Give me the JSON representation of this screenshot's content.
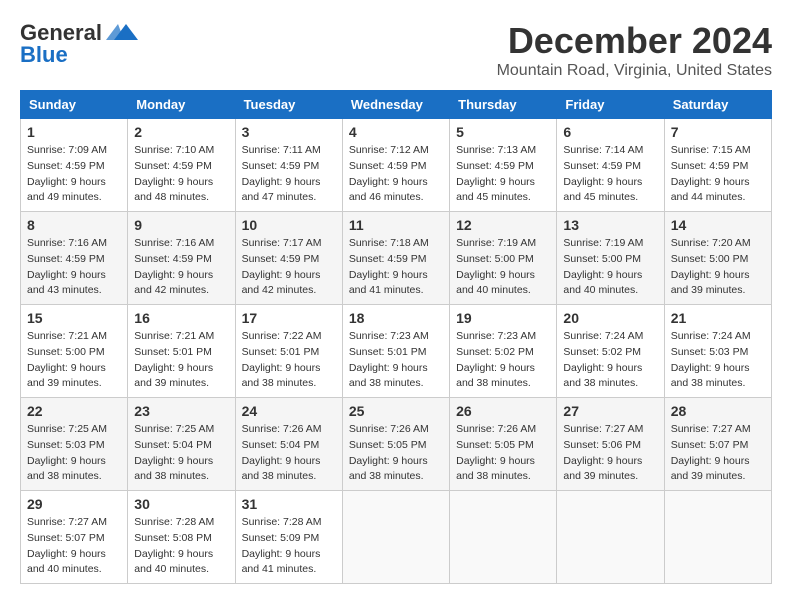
{
  "logo": {
    "line1": "General",
    "line2": "Blue"
  },
  "title": "December 2024",
  "location": "Mountain Road, Virginia, United States",
  "days_header": [
    "Sunday",
    "Monday",
    "Tuesday",
    "Wednesday",
    "Thursday",
    "Friday",
    "Saturday"
  ],
  "weeks": [
    [
      {
        "day": "1",
        "sunrise": "7:09 AM",
        "sunset": "4:59 PM",
        "daylight": "9 hours and 49 minutes."
      },
      {
        "day": "2",
        "sunrise": "7:10 AM",
        "sunset": "4:59 PM",
        "daylight": "9 hours and 48 minutes."
      },
      {
        "day": "3",
        "sunrise": "7:11 AM",
        "sunset": "4:59 PM",
        "daylight": "9 hours and 47 minutes."
      },
      {
        "day": "4",
        "sunrise": "7:12 AM",
        "sunset": "4:59 PM",
        "daylight": "9 hours and 46 minutes."
      },
      {
        "day": "5",
        "sunrise": "7:13 AM",
        "sunset": "4:59 PM",
        "daylight": "9 hours and 45 minutes."
      },
      {
        "day": "6",
        "sunrise": "7:14 AM",
        "sunset": "4:59 PM",
        "daylight": "9 hours and 45 minutes."
      },
      {
        "day": "7",
        "sunrise": "7:15 AM",
        "sunset": "4:59 PM",
        "daylight": "9 hours and 44 minutes."
      }
    ],
    [
      {
        "day": "8",
        "sunrise": "7:16 AM",
        "sunset": "4:59 PM",
        "daylight": "9 hours and 43 minutes."
      },
      {
        "day": "9",
        "sunrise": "7:16 AM",
        "sunset": "4:59 PM",
        "daylight": "9 hours and 42 minutes."
      },
      {
        "day": "10",
        "sunrise": "7:17 AM",
        "sunset": "4:59 PM",
        "daylight": "9 hours and 42 minutes."
      },
      {
        "day": "11",
        "sunrise": "7:18 AM",
        "sunset": "4:59 PM",
        "daylight": "9 hours and 41 minutes."
      },
      {
        "day": "12",
        "sunrise": "7:19 AM",
        "sunset": "5:00 PM",
        "daylight": "9 hours and 40 minutes."
      },
      {
        "day": "13",
        "sunrise": "7:19 AM",
        "sunset": "5:00 PM",
        "daylight": "9 hours and 40 minutes."
      },
      {
        "day": "14",
        "sunrise": "7:20 AM",
        "sunset": "5:00 PM",
        "daylight": "9 hours and 39 minutes."
      }
    ],
    [
      {
        "day": "15",
        "sunrise": "7:21 AM",
        "sunset": "5:00 PM",
        "daylight": "9 hours and 39 minutes."
      },
      {
        "day": "16",
        "sunrise": "7:21 AM",
        "sunset": "5:01 PM",
        "daylight": "9 hours and 39 minutes."
      },
      {
        "day": "17",
        "sunrise": "7:22 AM",
        "sunset": "5:01 PM",
        "daylight": "9 hours and 38 minutes."
      },
      {
        "day": "18",
        "sunrise": "7:23 AM",
        "sunset": "5:01 PM",
        "daylight": "9 hours and 38 minutes."
      },
      {
        "day": "19",
        "sunrise": "7:23 AM",
        "sunset": "5:02 PM",
        "daylight": "9 hours and 38 minutes."
      },
      {
        "day": "20",
        "sunrise": "7:24 AM",
        "sunset": "5:02 PM",
        "daylight": "9 hours and 38 minutes."
      },
      {
        "day": "21",
        "sunrise": "7:24 AM",
        "sunset": "5:03 PM",
        "daylight": "9 hours and 38 minutes."
      }
    ],
    [
      {
        "day": "22",
        "sunrise": "7:25 AM",
        "sunset": "5:03 PM",
        "daylight": "9 hours and 38 minutes."
      },
      {
        "day": "23",
        "sunrise": "7:25 AM",
        "sunset": "5:04 PM",
        "daylight": "9 hours and 38 minutes."
      },
      {
        "day": "24",
        "sunrise": "7:26 AM",
        "sunset": "5:04 PM",
        "daylight": "9 hours and 38 minutes."
      },
      {
        "day": "25",
        "sunrise": "7:26 AM",
        "sunset": "5:05 PM",
        "daylight": "9 hours and 38 minutes."
      },
      {
        "day": "26",
        "sunrise": "7:26 AM",
        "sunset": "5:05 PM",
        "daylight": "9 hours and 38 minutes."
      },
      {
        "day": "27",
        "sunrise": "7:27 AM",
        "sunset": "5:06 PM",
        "daylight": "9 hours and 39 minutes."
      },
      {
        "day": "28",
        "sunrise": "7:27 AM",
        "sunset": "5:07 PM",
        "daylight": "9 hours and 39 minutes."
      }
    ],
    [
      {
        "day": "29",
        "sunrise": "7:27 AM",
        "sunset": "5:07 PM",
        "daylight": "9 hours and 40 minutes."
      },
      {
        "day": "30",
        "sunrise": "7:28 AM",
        "sunset": "5:08 PM",
        "daylight": "9 hours and 40 minutes."
      },
      {
        "day": "31",
        "sunrise": "7:28 AM",
        "sunset": "5:09 PM",
        "daylight": "9 hours and 41 minutes."
      },
      null,
      null,
      null,
      null
    ]
  ]
}
